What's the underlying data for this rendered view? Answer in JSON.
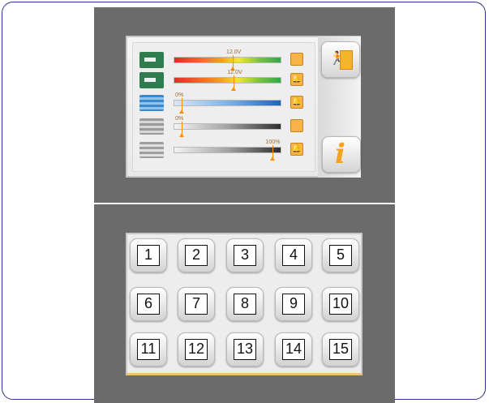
{
  "top_screen": {
    "rows": [
      {
        "icon": "fresh-water-tank-icon",
        "marker_label": "12.0V",
        "marker_pct": 0.55,
        "bar": "rg",
        "side": "square"
      },
      {
        "icon": "battery-icon",
        "marker_label": "12.0V",
        "marker_pct": 0.56,
        "bar": "rg",
        "side": "bell"
      },
      {
        "icon": "water-level-icon",
        "marker_label": "0%",
        "marker_pct": 0.07,
        "bar": "blue",
        "side": "bell"
      },
      {
        "icon": "grey-water-tank-icon",
        "marker_label": "0%",
        "marker_pct": 0.07,
        "bar": "grey",
        "side": "square"
      },
      {
        "icon": "black-water-tank-icon",
        "marker_label": "100%",
        "marker_pct": 0.92,
        "bar": "grey",
        "side": "bell"
      }
    ],
    "exit_icon": "exit-door-icon",
    "info_icon": "info-icon",
    "info_glyph": "i"
  },
  "keypad": {
    "keys": [
      "1",
      "2",
      "3",
      "4",
      "5",
      "6",
      "7",
      "8",
      "9",
      "10",
      "11",
      "12",
      "13",
      "14",
      "15"
    ]
  },
  "colors": {
    "panel": "#6b6b6b",
    "accent_orange": "#f6b42a",
    "frame_border": "#2f2f8c"
  }
}
